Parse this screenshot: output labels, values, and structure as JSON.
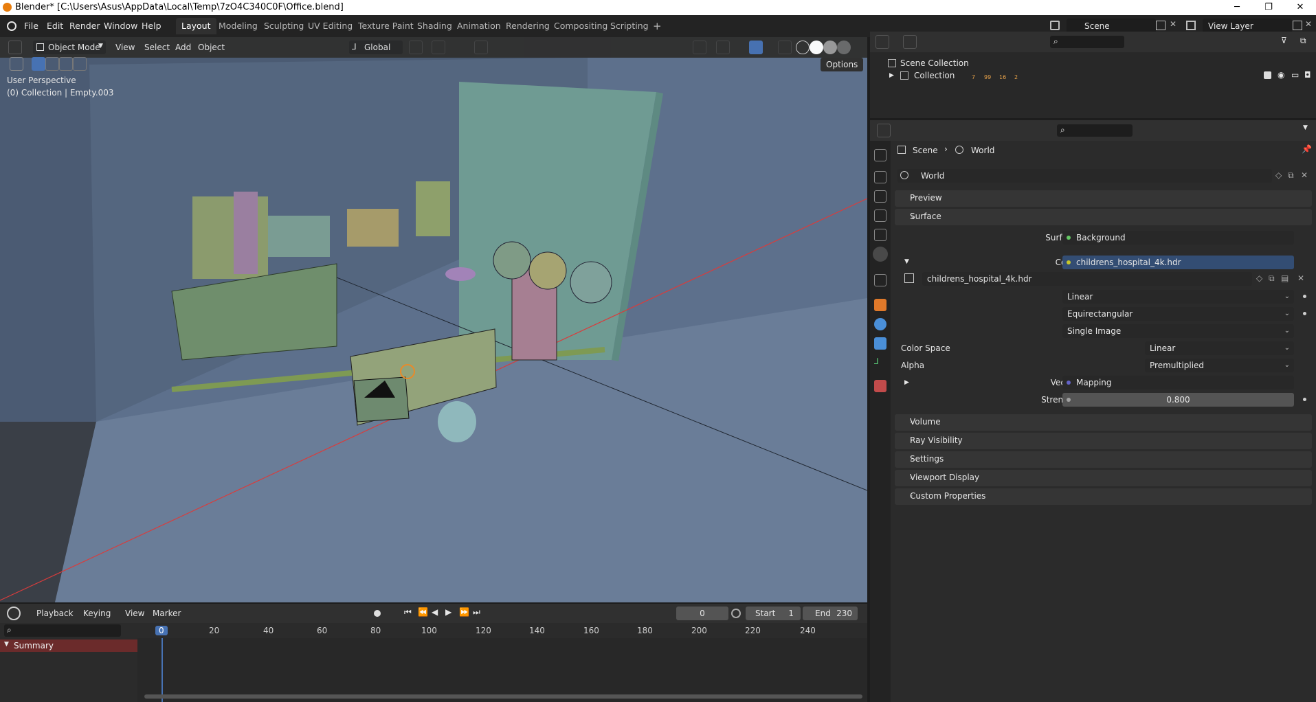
{
  "window": {
    "title": "Blender* [C:\\Users\\Asus\\AppData\\Local\\Temp\\7zO4C340C0F\\Office.blend]",
    "minimize": "─",
    "maximize": "❐",
    "close": "✕"
  },
  "menu": {
    "items": [
      "File",
      "Edit",
      "Render",
      "Window",
      "Help"
    ],
    "workspaces": [
      "Layout",
      "Modeling",
      "Sculpting",
      "UV Editing",
      "Texture Paint",
      "Shading",
      "Animation",
      "Rendering",
      "Compositing",
      "Scripting"
    ],
    "add_workspace": "+",
    "scene_name": "Scene",
    "view_layer": "View Layer"
  },
  "viewport": {
    "mode": "Object Mode",
    "menus": [
      "View",
      "Select",
      "Add",
      "Object"
    ],
    "transform": "Global",
    "options": "Options",
    "overlay_line1": "User Perspective",
    "overlay_line2": "(0) Collection | Empty.003"
  },
  "timeline": {
    "menus": [
      "Playback",
      "Keying",
      "View",
      "Marker"
    ],
    "current_frame": "0",
    "start_label": "Start",
    "start_value": "1",
    "end_label": "End",
    "end_value": "230",
    "ticks": [
      "0",
      "20",
      "40",
      "60",
      "80",
      "100",
      "120",
      "140",
      "160",
      "180",
      "200",
      "220",
      "240"
    ],
    "summary": "Summary"
  },
  "outliner": {
    "scene_collection": "Scene Collection",
    "collection": "Collection",
    "counts": [
      "7",
      "99",
      "16",
      "2"
    ]
  },
  "properties": {
    "breadcrumb_scene": "Scene",
    "breadcrumb_world": "World",
    "world_name": "World",
    "panels_top": [
      "Preview",
      "Surface"
    ],
    "surface_label": "Surface",
    "surface_value": "Background",
    "color_label": "Color",
    "color_value": "childrens_hospital_4k.hdr",
    "image_name": "childrens_hospital_4k.hdr",
    "interpolation": "Linear",
    "projection": "Equirectangular",
    "source": "Single Image",
    "color_space_label": "Color Space",
    "color_space_value": "Linear",
    "alpha_label": "Alpha",
    "alpha_value": "Premultiplied",
    "vector_label": "Vector",
    "vector_value": "Mapping",
    "strength_label": "Strength",
    "strength_value": "0.800",
    "panels_bottom": [
      "Volume",
      "Ray Visibility",
      "Settings",
      "Viewport Display",
      "Custom Properties"
    ]
  },
  "colors": {
    "accent": "#4772b3",
    "node_socket_green": "#63c763",
    "node_socket_yellow": "#c7c729",
    "node_socket_purple": "#6363c7",
    "axis_red": "#d93c3c"
  }
}
